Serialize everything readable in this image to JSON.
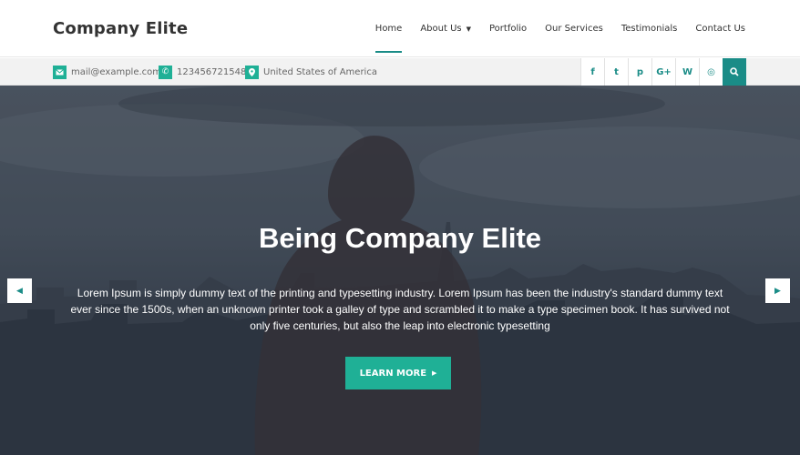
{
  "header": {
    "logo": "Company Elite",
    "nav": [
      {
        "label": "Home",
        "active": true
      },
      {
        "label": "About Us",
        "dropdown": true
      },
      {
        "label": "Portfolio"
      },
      {
        "label": "Our Services"
      },
      {
        "label": "Testimonials"
      },
      {
        "label": "Contact Us"
      }
    ]
  },
  "topbar": {
    "email": "mail@example.com",
    "phone": "123456721548",
    "location": "United States of America",
    "socials": [
      "facebook-icon",
      "twitter-icon",
      "pinterest-icon",
      "google-plus-icon",
      "wordpress-icon",
      "instagram-icon"
    ],
    "social_glyphs": [
      "f",
      "t",
      "p",
      "G+",
      "W",
      "◎"
    ]
  },
  "hero": {
    "title": "Being Company Elite",
    "text": "Lorem Ipsum is simply dummy text of the printing and typesetting industry. Lorem Ipsum has been the industry's standard dummy text ever since the 1500s, when an unknown printer took a galley of type and scrambled it to make a type specimen book. It has survived not only five centuries, but also the leap into electronic typesetting",
    "button_label": "LEARN MORE"
  },
  "colors": {
    "accent": "#1a8c87",
    "button": "#1fb096"
  }
}
